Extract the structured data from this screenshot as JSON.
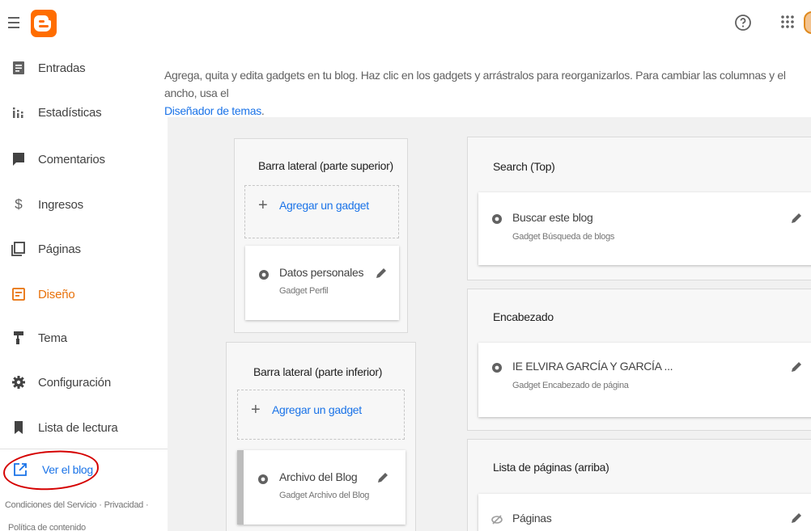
{
  "sidebar": {
    "items": [
      {
        "label": "Entradas",
        "icon": "posts-icon"
      },
      {
        "label": "Estadísticas",
        "icon": "stats-icon"
      },
      {
        "label": "Comentarios",
        "icon": "comments-icon"
      },
      {
        "label": "Ingresos",
        "icon": "dollar-icon"
      },
      {
        "label": "Páginas",
        "icon": "pages-icon"
      },
      {
        "label": "Diseño",
        "icon": "layout-icon"
      },
      {
        "label": "Tema",
        "icon": "paint-roller-icon"
      },
      {
        "label": "Configuración",
        "icon": "gear-icon"
      },
      {
        "label": "Lista de lectura",
        "icon": "bookmark-icon"
      }
    ],
    "view_blog": "Ver el blog",
    "footer": {
      "terms": "Condiciones del Servicio",
      "privacy": "Privacidad",
      "sep": "·",
      "content_policy": "Política de contenido"
    }
  },
  "colors": {
    "accent": "#e8710a",
    "link": "#1a73e8",
    "brand": "#ff6d00",
    "annotation": "#d50000"
  },
  "main": {
    "intro_text": "Agrega, quita y edita gadgets en tu blog. Haz clic en los gadgets y arrástralos para reorganizarlos. Para cambiar las columnas y el ancho, usa el",
    "intro_link": "Diseñador de temas",
    "intro_end": ".",
    "add_gadget": "Agregar un gadget",
    "plus": "+",
    "sections": {
      "sidebar_top": {
        "title": "Barra lateral (parte superior)",
        "gadget": {
          "title": "Datos personales",
          "sub": "Gadget Perfil"
        }
      },
      "sidebar_bottom": {
        "title": "Barra lateral (parte inferior)",
        "gadget": {
          "title": "Archivo del Blog",
          "sub": "Gadget Archivo del Blog"
        }
      },
      "search": {
        "title": "Search (Top)",
        "gadget": {
          "title": "Buscar este blog",
          "sub": "Gadget Búsqueda de blogs"
        }
      },
      "header": {
        "title": "Encabezado",
        "gadget": {
          "title": "IE ELVIRA GARCÍA Y GARCÍA ...",
          "sub": "Gadget Encabezado de página"
        }
      },
      "pages_list": {
        "title": "Lista de páginas (arriba)",
        "gadget": {
          "title": "Páginas"
        }
      }
    }
  }
}
